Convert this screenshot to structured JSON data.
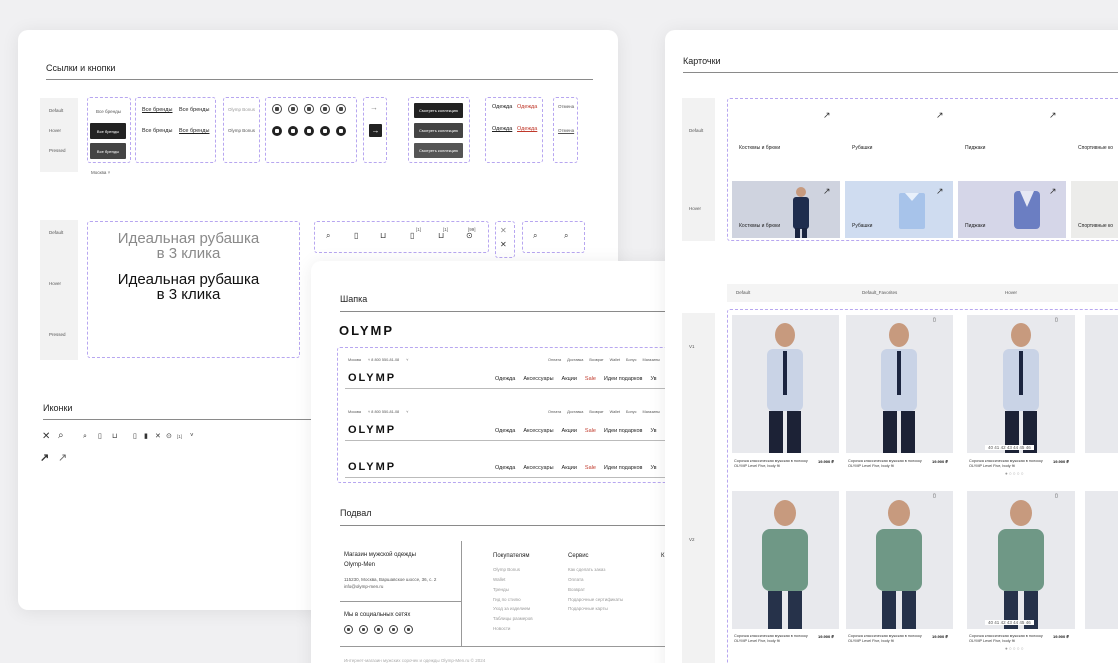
{
  "links": {
    "title": "Ссылки и кнопки",
    "states": [
      "Default",
      "Hover",
      "Pressed"
    ],
    "btn_brands": "Все бренды",
    "bonus": "Olymp Bonus",
    "collection": "Смотреть коллекцию",
    "clothes": "Одежда",
    "more": "Отмена",
    "moscow": "Москва"
  },
  "hero": {
    "states": [
      "Default",
      "Hover",
      "Pressed"
    ],
    "line1": "Идеальная рубашка",
    "line2": "в 3 клика",
    "icon_counts": [
      "[1]",
      "[1]",
      "[99]"
    ]
  },
  "icons": {
    "title": "Иконки",
    "count": "[1]"
  },
  "header": {
    "title": "Шапка",
    "logo": "OLYMP",
    "city": "Москва",
    "phone": "8 800 550-81-08",
    "top_links": [
      "Оплата",
      "Доставка",
      "Возврат",
      "Wallet",
      "Бонус",
      "Магазины"
    ],
    "nav": [
      "Одежда",
      "Аксессуары",
      "Акции",
      "Sale",
      "Идеи подарков",
      "Ув"
    ]
  },
  "footer": {
    "title": "Подвал",
    "shop_line1": "Магазин мужской одежды",
    "shop_line2": "Olymp-Men",
    "addr1": "115230, Москва, Варшавское шоссе, 36, с. 2",
    "addr2": "info@olymp-men.ru",
    "social": "Мы в социальных сетях",
    "col1_title": "Покупателям",
    "col1": [
      "Olymp Bonus",
      "Wallet",
      "Тренды",
      "Гид по стилю",
      "Уход за изделием",
      "Таблицы размеров",
      "Новости"
    ],
    "col2_title": "Сервис",
    "col2": [
      "Как сделать заказ",
      "Оплата",
      "Возврат",
      "Подарочные сертификаты",
      "Подарочные карты"
    ],
    "col3_title": "К",
    "copyright": "Интернет-магазин мужских сорочек и одежды Olymp-Men.ru © 2024"
  },
  "cards": {
    "title": "Карточки",
    "states": [
      "Default",
      "Hover"
    ],
    "categories": [
      "Костюмы и брюки",
      "Рубашки",
      "Пиджаки",
      "Спортивные ко"
    ],
    "col_labels": [
      "Default",
      "Default_Favorites",
      "Hover"
    ],
    "rows": [
      "V1",
      "V2"
    ],
    "product": "Сорочка классическая мужская в полоску OLYMP Level Five, body fit",
    "price": "19.900 ₽",
    "sizes": [
      "40",
      "41",
      "42",
      "43",
      "44",
      "45",
      "46"
    ]
  },
  "colors": {
    "accent": "#c0392b",
    "dashed": "#b7a6f0",
    "dark": "#222222"
  }
}
